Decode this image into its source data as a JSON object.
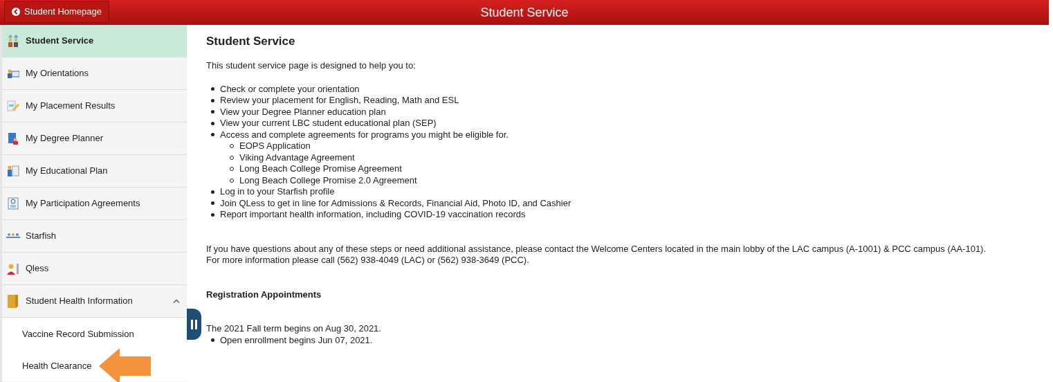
{
  "header": {
    "back_button": "Student Homepage",
    "title": "Student Service"
  },
  "sidebar": {
    "items": [
      {
        "kind": "nav",
        "label": "Student Service",
        "selected": true
      },
      {
        "kind": "nav",
        "label": "My Orientations",
        "selected": false
      },
      {
        "kind": "nav",
        "label": "My Placement Results",
        "selected": false
      },
      {
        "kind": "nav",
        "label": "My Degree Planner",
        "selected": false
      },
      {
        "kind": "nav",
        "label": "My Educational Plan",
        "selected": false
      },
      {
        "kind": "nav",
        "label": "My Participation Agreements",
        "selected": false
      },
      {
        "kind": "nav",
        "label": "Starfish",
        "selected": false
      },
      {
        "kind": "nav",
        "label": "Qless",
        "selected": false
      },
      {
        "kind": "folder",
        "label": "Student Health Information",
        "selected": false,
        "expanded": true,
        "children": [
          {
            "label": "Vaccine Record Submission",
            "selected": false
          },
          {
            "label": "Health Clearance",
            "selected": false
          }
        ]
      }
    ]
  },
  "content": {
    "heading": "Student Service",
    "intro": "This student service page is designed to help you to:",
    "bullets": [
      {
        "text": "Check or complete your orientation"
      },
      {
        "text": "Review your placement for English, Reading, Math and ESL"
      },
      {
        "text": "View your Degree Planner education plan"
      },
      {
        "text": "View your current LBC student educational plan (SEP)"
      },
      {
        "text": "Access and complete agreements for programs you might be eligible for.",
        "children": [
          {
            "text": "EOPS Application"
          },
          {
            "text": "Viking Advantage Agreement"
          },
          {
            "text": "Long Beach College Promise Agreement"
          },
          {
            "text": "Long Beach College Promise 2.0 Agreement"
          }
        ]
      },
      {
        "text": "Log in to your Starfish profile"
      },
      {
        "text": "Join QLess to get in line for Admissions & Records, Financial Aid, Photo ID, and Cashier"
      },
      {
        "text": "Report important health information, including COVID-19 vaccination records"
      }
    ],
    "contact": [
      "If you have questions about any of these steps or need additional assistance, please contact the Welcome Centers located in the main lobby of the LAC campus (A-1001) & PCC campus (AA-101).",
      "For more information please call (562) 938-4049 (LAC) or (562) 938-3649 (PCC)."
    ],
    "registration": {
      "heading": "Registration Appointments",
      "term": "The 2021 Fall term begins on Aug 30, 2021.",
      "bullets": [
        {
          "text": "Open enrollment begins Jun 07, 2021."
        }
      ]
    }
  }
}
